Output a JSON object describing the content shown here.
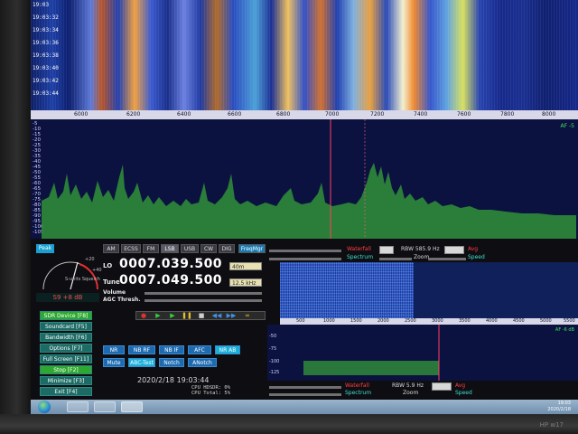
{
  "waterfall": {
    "timestamps": [
      "19:03",
      "19:03:32",
      "19:03:34",
      "19:03:36",
      "19:03:38",
      "19:03:40",
      "19:03:42",
      "19:03:44"
    ]
  },
  "frequency_axis": {
    "ticks": [
      "6000",
      "6200",
      "6400",
      "6600",
      "6800",
      "7000",
      "7200",
      "7400",
      "7600",
      "7800",
      "8000"
    ]
  },
  "spectrum": {
    "db_labels": [
      "-5",
      "-10",
      "-15",
      "-20",
      "-25",
      "-30",
      "-35",
      "-40",
      "-45",
      "-50",
      "-55",
      "-60",
      "-65",
      "-70",
      "-75",
      "-80",
      "-85",
      "-90",
      "-95",
      "-100",
      "-105"
    ],
    "af_label": "AF -5"
  },
  "meter": {
    "peak_label": "Peak",
    "squelch_label": "S-units Squelch",
    "scale_marks": [
      "+20",
      "+40"
    ],
    "readout": "S9 +8 dB"
  },
  "side_buttons": {
    "sdr_device": "SDR Device [F8]",
    "soundcard": "Soundcard [F5]",
    "bandwidth": "Bandwidth [F6]",
    "options": "Options [F7]",
    "full_screen": "Full Screen [F11]",
    "stop": "Stop [F2]",
    "minimize": "Minimize [F3]",
    "exit": "Exit [F4]"
  },
  "modes": {
    "am": "AM",
    "ecss": "ECSS",
    "fm": "FM",
    "lsb": "LSB",
    "usb": "USB",
    "cw": "CW",
    "dig": "DIG",
    "freqmgr": "FreqMgr"
  },
  "tuning": {
    "lo_label": "LO",
    "lo_freq": "0007.039.500",
    "tune_label": "Tune",
    "tune_freq": "0007.049.500",
    "band": "40m",
    "step": "12.5 kHz",
    "volume_label": "Volume",
    "agc_label": "AGC Thresh."
  },
  "transport": {
    "record": "●",
    "play": "▶",
    "play_alt": "▶",
    "pause": "❚❚",
    "stop": "■",
    "rewind": "◀◀",
    "forward": "▶▶",
    "loop": "∞"
  },
  "dsp": {
    "nr": "NR",
    "nb_rf": "NB RF",
    "nb_if": "NB IF",
    "afc": "AFC",
    "nr_extra": "NR AB",
    "mute": "Mute",
    "abc_test": "ABC-Test",
    "notch": "Notch",
    "anotch": "ANotch"
  },
  "status": {
    "datetime": "2020/2/18 19:03:44",
    "cpu_hdsdr": "CPU HDSDR: 0%",
    "cpu_total": "CPU Total: 5%"
  },
  "top_controls": {
    "waterfall_label": "Waterfall",
    "spectrum_label": "Spectrum",
    "rbw": "RBW 585.9 Hz",
    "avg": "Avg",
    "zoom": "Zoom",
    "speed": "Speed"
  },
  "mini_axis": {
    "ticks": [
      "500",
      "1000",
      "1500",
      "2000",
      "2500",
      "3000",
      "3500",
      "4000",
      "4500",
      "5000",
      "5500"
    ]
  },
  "mini_spectrum": {
    "db_labels": [
      "-50",
      "-75",
      "-100",
      "-125"
    ],
    "af_label": "AF -6 dB"
  },
  "bottom_controls": {
    "waterfall_label": "Waterfall",
    "spectrum_label": "Spectrum",
    "rbw": "RBW 5.9 Hz",
    "avg": "Avg",
    "zoom": "Zoom",
    "speed": "Speed"
  },
  "taskbar": {
    "clock_time": "19:03",
    "clock_date": "2020/2/18"
  },
  "bezel": {
    "brand": "HP w17"
  },
  "colors": {
    "accent_blue": "#1a7ab0",
    "spectrum_fill": "#3a9a3a",
    "marker_red": "#ff4060"
  }
}
